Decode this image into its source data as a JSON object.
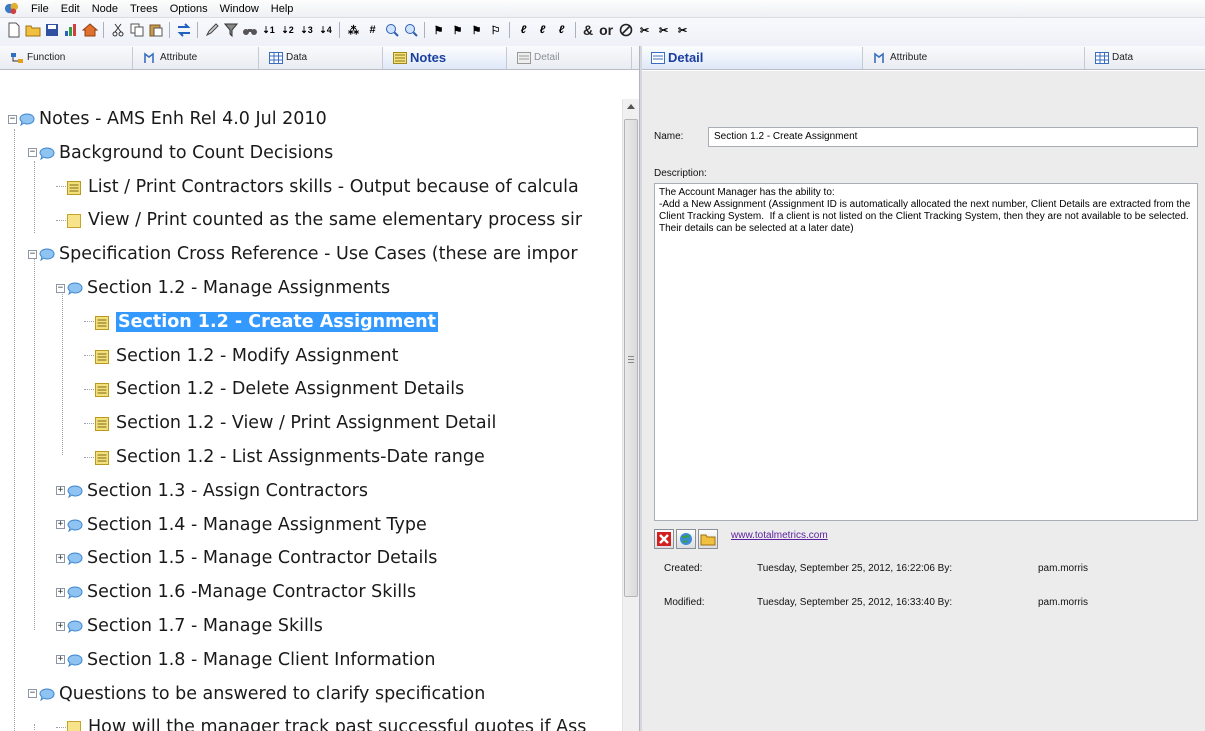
{
  "menubar": {
    "items": [
      "File",
      "Edit",
      "Node",
      "Trees",
      "Options",
      "Window",
      "Help"
    ]
  },
  "toolbar": {
    "and_label": "&",
    "or_label": "or"
  },
  "left_tabs": [
    {
      "label": "Function",
      "icon": "function-icon"
    },
    {
      "label": "Attribute",
      "icon": "attribute-icon"
    },
    {
      "label": "Data",
      "icon": "data-grid-icon"
    },
    {
      "label": "Notes",
      "icon": "notes-icon"
    },
    {
      "label": "Detail",
      "icon": "detail-icon"
    }
  ],
  "right_tabs": [
    {
      "label": "Detail",
      "icon": "detail-icon"
    },
    {
      "label": "Attribute",
      "icon": "attribute-icon"
    },
    {
      "label": "Data",
      "icon": "data-grid-icon"
    }
  ],
  "tree": {
    "nodes": [
      {
        "label": "Notes - AMS Enh Rel 4.0 Jul 2010",
        "level": 0,
        "type": "folder",
        "expand": "minus"
      },
      {
        "label": "Background to Count Decisions",
        "level": 1,
        "type": "folder",
        "expand": "minus"
      },
      {
        "label": "List / Print Contractors skills - Output because of calcula",
        "level": 2,
        "type": "note-lines"
      },
      {
        "label": "View / Print counted as the same elementary process sir",
        "level": 2,
        "type": "note-blank"
      },
      {
        "label": "Specification Cross Reference - Use Cases (these are impor",
        "level": 1,
        "type": "folder",
        "expand": "minus"
      },
      {
        "label": "Section 1.2 - Manage Assignments",
        "level": 2,
        "type": "folder",
        "expand": "minus"
      },
      {
        "label": "Section 1.2 - Create Assignment",
        "level": 3,
        "type": "note-lines",
        "selected": true
      },
      {
        "label": "Section 1.2 - Modify Assignment",
        "level": 3,
        "type": "note-lines"
      },
      {
        "label": "Section 1.2 - Delete Assignment Details",
        "level": 3,
        "type": "note-lines"
      },
      {
        "label": "Section 1.2 - View / Print Assignment Detail",
        "level": 3,
        "type": "note-lines"
      },
      {
        "label": "Section 1.2 - List Assignments-Date range",
        "level": 3,
        "type": "note-lines"
      },
      {
        "label": "Section 1.3 - Assign Contractors",
        "level": 2,
        "type": "folder",
        "expand": "plus"
      },
      {
        "label": "Section 1.4 - Manage Assignment Type",
        "level": 2,
        "type": "folder",
        "expand": "plus"
      },
      {
        "label": "Section 1.5 - Manage Contractor Details",
        "level": 2,
        "type": "folder",
        "expand": "plus"
      },
      {
        "label": "Section 1.6 -Manage Contractor Skills",
        "level": 2,
        "type": "folder",
        "expand": "plus"
      },
      {
        "label": "Section 1.7 - Manage Skills",
        "level": 2,
        "type": "folder",
        "expand": "plus"
      },
      {
        "label": "Section 1.8 - Manage Client Information",
        "level": 2,
        "type": "folder",
        "expand": "plus"
      },
      {
        "label": "Questions to be answered to clarify specification",
        "level": 1,
        "type": "folder",
        "expand": "minus"
      },
      {
        "label": "How will the manager track past successful quotes if Ass",
        "level": 2,
        "type": "note-blank"
      }
    ]
  },
  "detail": {
    "name_label": "Name:",
    "name_value": "Section 1.2 - Create Assignment",
    "description_label": "Description:",
    "description": "The Account Manager has the ability to:\n-Add a New Assignment (Assignment ID is automatically allocated the next number, Client Details are extracted from the Client Tracking System.  If a client is not listed on the Client Tracking System, then they are not available to be selected. Their details can be selected at a later date)",
    "link": "www.totalmetrics.com",
    "created_label": "Created:",
    "created_value": "Tuesday, September 25, 2012, 16:22:06 By:",
    "created_by": "pam.morris",
    "modified_label": "Modified:",
    "modified_value": "Tuesday, September 25, 2012, 16:33:40 By:",
    "modified_by": "pam.morris"
  },
  "colors": {
    "selection": "#3399ff",
    "active_tab_text": "#1a3fa0",
    "link": "#5a1f9f"
  }
}
